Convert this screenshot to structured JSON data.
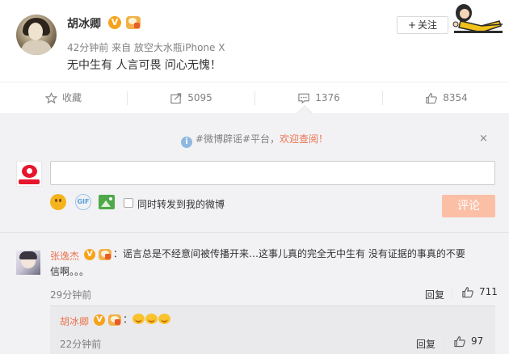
{
  "post": {
    "username": "胡冰卿",
    "v_badge": "V",
    "meta": "42分钟前 来自 放空大水瓶iPhone X",
    "text": "无中生有 人言可畏 问心无愧！",
    "follow_label": "关注",
    "follow_plus": "+"
  },
  "actions": {
    "favorite_label": "收藏",
    "repost_count": "5095",
    "comment_count": "1376",
    "like_count": "8354"
  },
  "comment_box": {
    "notice_prefix": "#微博辟谣#平台，",
    "notice_link": "欢迎查阅！",
    "notice_close": "×",
    "gif_label": "GIF",
    "repost_label": "同时转发到我的微博",
    "submit_label": "评论"
  },
  "comments": [
    {
      "username": "张逸杰",
      "v_badge": "V",
      "text_line1": "：谣言总是不经意间被传播开来…这事儿真的完全无中生有 没有证据的事真的不要",
      "text_line2": "信啊。。。",
      "time": "29分钟前",
      "reply_label": "回复",
      "like_count": "711"
    }
  ],
  "sub_comment": {
    "username": "胡冰卿",
    "v_badge": "V",
    "colon": "：",
    "time": "22分钟前",
    "reply_label": "回复",
    "like_count": "97"
  },
  "colors": {
    "accent_orange": "#eb7350",
    "badge_orange": "#f7a21b",
    "panel_bg": "#f2f2f5",
    "submit_disabled": "#fbbfa6"
  }
}
